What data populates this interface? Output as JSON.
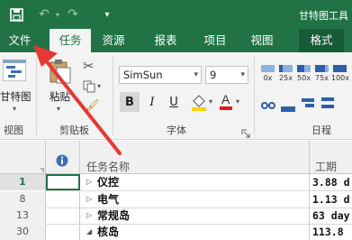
{
  "window": {
    "title": "甘特图工具"
  },
  "quick_access": {
    "save_icon": "save-icon",
    "undo_icon": "undo-icon",
    "redo_icon": "redo-icon"
  },
  "tabs": [
    {
      "label": "文件",
      "active": false
    },
    {
      "label": "任务",
      "active": true
    },
    {
      "label": "资源",
      "active": false
    },
    {
      "label": "报表",
      "active": false
    },
    {
      "label": "项目",
      "active": false
    },
    {
      "label": "视图",
      "active": false
    },
    {
      "label": "格式",
      "active": false
    }
  ],
  "ribbon": {
    "view_group": {
      "label": "视图",
      "button": "甘特图"
    },
    "clipboard_group": {
      "label": "剪贴板",
      "paste": "粘贴"
    },
    "font_group": {
      "label": "字体",
      "font_name": "SimSun",
      "font_size": "9",
      "bold": "B",
      "italic": "I",
      "underline": "U"
    },
    "schedule_group": {
      "label": "日程",
      "progress_labels": [
        "0x",
        "25x",
        "50x",
        "75x",
        "100x"
      ]
    }
  },
  "grid": {
    "info_header_icon": "info-icon",
    "column_task_name": "任务名称",
    "column_duration": "工期",
    "rows": [
      {
        "num": "1",
        "name": "仪控",
        "duration": "3.88 d",
        "selected": true
      },
      {
        "num": "8",
        "name": "电气",
        "duration": "1.13 d",
        "selected": false
      },
      {
        "num": "13",
        "name": "常规岛",
        "duration": "63 day",
        "selected": false
      },
      {
        "num": "30",
        "name": "核岛",
        "duration": "113.8",
        "selected": false
      }
    ]
  },
  "colors": {
    "accent": "#217346",
    "annotation_arrow": "#e53935"
  }
}
